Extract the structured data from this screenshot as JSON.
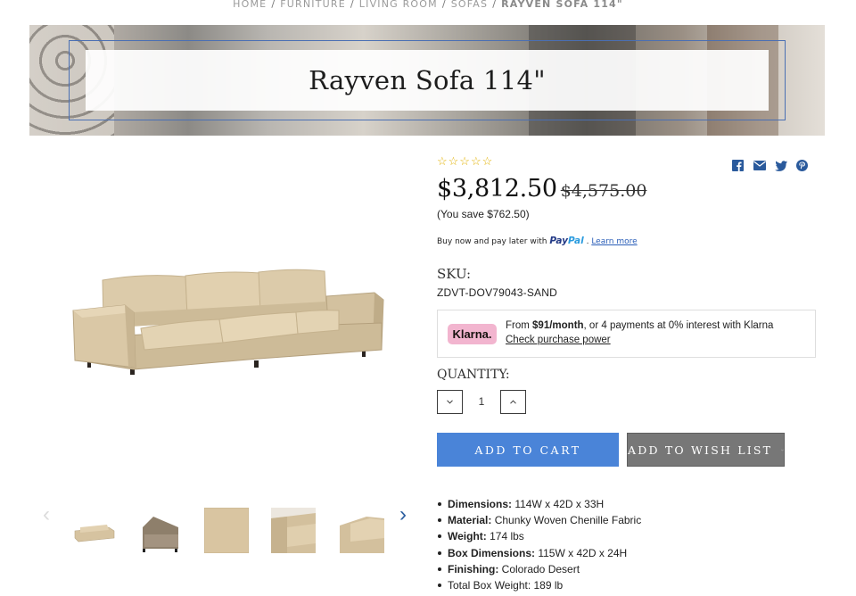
{
  "breadcrumb": {
    "items": [
      "Home",
      "Furniture",
      "Living Room",
      "Sofas"
    ],
    "current": "Rayven Sofa 114\"",
    "separator": "/"
  },
  "product": {
    "title": "Rayven Sofa 114\"",
    "rating_stars": "☆☆☆☆☆",
    "price_now": "$3,812.50",
    "price_was": "$4,575.00",
    "you_save": "(You save $762.50)",
    "sku_label": "SKU:",
    "sku_value": "ZDVT-DOV79043-SAND"
  },
  "paypal": {
    "text": "Buy now and pay later with",
    "logo_part1": "Pay",
    "logo_part2": "Pal",
    "dot": ".",
    "learn_more": "Learn more"
  },
  "klarna": {
    "badge": "Klarna.",
    "from": "From ",
    "amount": "$91/month",
    "rest": ", or 4 payments at 0% interest with Klarna",
    "link": "Check purchase power"
  },
  "quantity": {
    "label": "QUANTITY:",
    "value": "1"
  },
  "buttons": {
    "add_to_cart": "ADD TO CART",
    "add_to_wishlist": "ADD TO WISH LIST"
  },
  "share": {
    "icons": [
      "facebook-icon",
      "email-icon",
      "twitter-icon",
      "pinterest-icon"
    ]
  },
  "specs": [
    {
      "key": "Dimensions:",
      "value": " 114W x 42D x 33H"
    },
    {
      "key": "Material:",
      "value": " Chunky Woven Chenille Fabric"
    },
    {
      "key": "Weight:",
      "value": " 174 lbs"
    },
    {
      "key": "Box Dimensions:",
      "value": " 115W x 42D x 24H"
    },
    {
      "key": "Finishing:",
      "value": " Colorado Desert"
    },
    {
      "key": "",
      "value": "Total Box Weight: 189 lb"
    }
  ],
  "colors": {
    "accent_blue": "#4a84d8",
    "wish_gray": "#777777",
    "klarna_pink": "#f2b5cf",
    "sofa_beige": "#d7c6a4"
  }
}
